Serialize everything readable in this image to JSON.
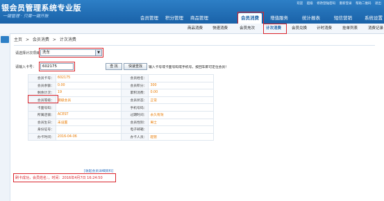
{
  "header": {
    "title": "银会员管理系统专业版",
    "subtitle": "一键管理 · 只需一键开账",
    "toplinks": [
      "欢迎",
      "超级",
      "修改登陆密码",
      "重新登录",
      "帮助二维码",
      "退出"
    ],
    "main_nav": [
      "会员管理",
      "积分管理",
      "商品管理",
      "会员消费",
      "增值服务",
      "统计报表",
      "短信营销",
      "系统设置"
    ],
    "active_main": "会员消费"
  },
  "subnav": {
    "items": [
      "商品消费",
      "快速消费",
      "会员充次",
      "计次消费",
      "会员兑换",
      "计时消费",
      "挂单列表",
      "消费记录"
    ],
    "active": "计次消费"
  },
  "breadcrumb": [
    "主页",
    ">",
    "会员消费",
    ">",
    "计次消费"
  ],
  "form": {
    "project_label": "请选择计次项目：",
    "project_value": "洗车",
    "card_label": "请输入卡号：",
    "card_value": "602175",
    "search_button": "查 找",
    "quick_search_button": "快速查找",
    "hint": "输入卡号或卡面号码或手机号，按回车即可定位会员！"
  },
  "member": {
    "rows": [
      {
        "l1": "会员卡号：",
        "v1": "602175",
        "l2": "会员姓名：",
        "v2": ""
      },
      {
        "l1": "会员余额：",
        "v1": "0.00",
        "l2": "会员积分：",
        "v2": "300"
      },
      {
        "l1": "剩余计次：",
        "v1": "19",
        "l2": "累积消费：",
        "v2": "0.00"
      },
      {
        "l1": "会员等级：",
        "v1": "铜级会员",
        "l2": "会员状态：",
        "v2": "正常"
      },
      {
        "l1": "卡面号码：",
        "v1": "",
        "l2": "手机号码：",
        "v2": ""
      },
      {
        "l1": "所属店铺：",
        "v1": "ACEST",
        "l2": "过期时间：",
        "v2": "永久有效"
      },
      {
        "l1": "会员生日：",
        "v1": "未设置",
        "l2": "会员性别：",
        "v2": "男士"
      },
      {
        "l1": "身份证号：",
        "v1": "",
        "l2": "电子邮箱：",
        "v2": ""
      },
      {
        "l1": "办卡时间：",
        "v1": "2016-04-06",
        "l2": "办卡人员：",
        "v2": "超管"
      }
    ],
    "details_link": "[收起会员详细资料]"
  },
  "status_message": "刷卡成功，会员姓名：，时间：2016年4月7日 16:24:50",
  "colors": {
    "accent": "#1a62a8",
    "highlight": "#d9242b",
    "value": "#e87a00"
  }
}
